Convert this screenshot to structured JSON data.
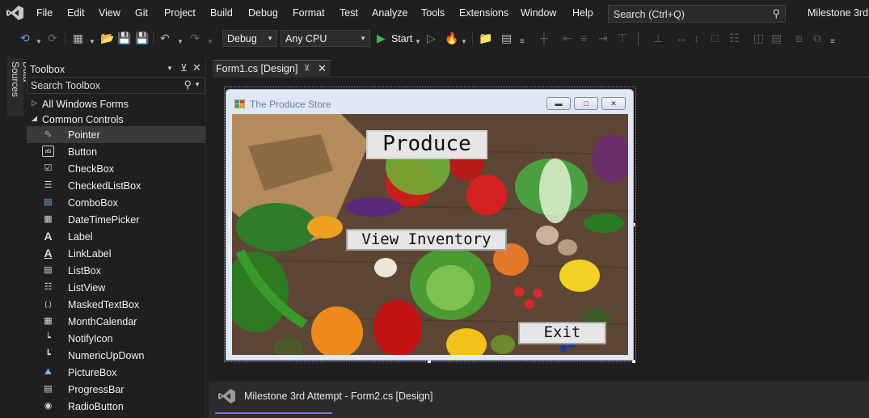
{
  "menu": {
    "items": [
      "File",
      "Edit",
      "View",
      "Git",
      "Project",
      "Build",
      "Debug",
      "Format",
      "Test",
      "Analyze",
      "Tools",
      "Extensions",
      "Window",
      "Help"
    ],
    "search_placeholder": "Search (Ctrl+Q)",
    "solution_name": "Milestone 3rd"
  },
  "toolbar": {
    "config": "Debug",
    "platform": "Any CPU",
    "start_label": "Start"
  },
  "side_tab": {
    "data_sources": "Data Sources"
  },
  "toolbox": {
    "title": "Toolbox",
    "search_placeholder": "Search Toolbox",
    "groups": [
      "All Windows Forms",
      "Common Controls"
    ],
    "tools": [
      "Pointer",
      "Button",
      "CheckBox",
      "CheckedListBox",
      "ComboBox",
      "DateTimePicker",
      "Label",
      "LinkLabel",
      "ListBox",
      "ListView",
      "MaskedTextBox",
      "MonthCalendar",
      "NotifyIcon",
      "NumericUpDown",
      "PictureBox",
      "ProgressBar",
      "RadioButton"
    ],
    "selected_tool": "Pointer"
  },
  "document": {
    "tab_title": "Form1.cs [Design]",
    "second_window_title": "Milestone 3rd Attempt - Form2.cs [Design]"
  },
  "form": {
    "title": "The Produce Store",
    "heading": "Produce",
    "view_inventory_label": "View Inventory",
    "exit_label": "Exit"
  },
  "colors": {
    "background": "#1f1f1f",
    "accent": "#8c6ad9",
    "start_green": "#3fb950"
  }
}
